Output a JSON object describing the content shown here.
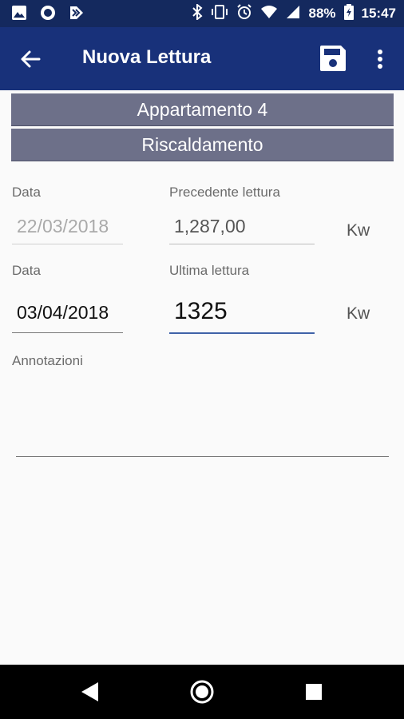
{
  "status": {
    "battery": "88%",
    "time": "15:47"
  },
  "appbar": {
    "title": "Nuova Lettura"
  },
  "headers": {
    "apartment": "Appartamento 4",
    "category": "Riscaldamento"
  },
  "form": {
    "prev_date_label": "Data",
    "prev_date_value": "22/03/2018",
    "prev_reading_label": "Precedente lettura",
    "prev_reading_value": "1,287,00",
    "prev_unit": "Kw",
    "last_date_label": "Data",
    "last_date_value": "03/04/2018",
    "last_reading_label": "Ultima lettura",
    "last_reading_value": "1325",
    "last_unit": "Kw",
    "notes_label": "Annotazioni",
    "notes_value": ""
  },
  "colors": {
    "app_bar": "#18317a",
    "header_bar": "#6d7089",
    "focus_underline": "#3f62a8"
  }
}
